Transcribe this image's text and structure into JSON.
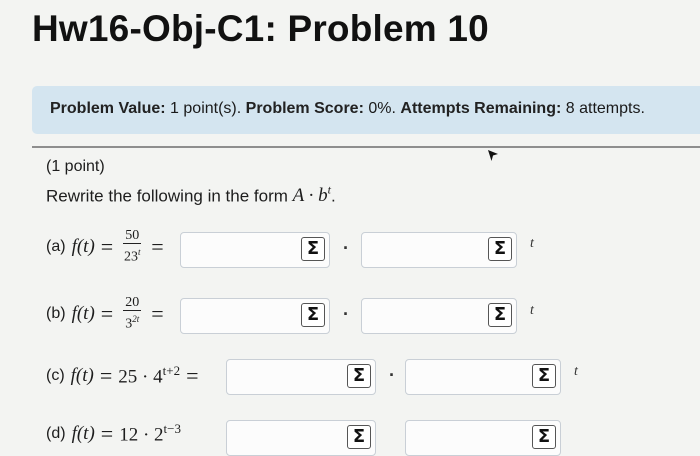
{
  "page": {
    "title": "Hw16-Obj-C1: Problem 10"
  },
  "status": {
    "value_label": "Problem Value:",
    "value_text": "1 point(s).",
    "score_label": "Problem Score:",
    "score_text": "0%.",
    "attempts_label": "Attempts Remaining:",
    "attempts_text": "8 attempts."
  },
  "problem": {
    "points": "(1 point)",
    "instructions_prefix": "Rewrite the following in the form",
    "form_expression": "A · b",
    "form_exponent": "t",
    "form_suffix": "."
  },
  "parts": [
    {
      "label": "(a)",
      "lhs": "f(t)",
      "numerator": "50",
      "denominator_base": "23",
      "denominator_exp": "t"
    },
    {
      "label": "(b)",
      "lhs": "f(t)",
      "numerator": "20",
      "denominator_base": "3",
      "denominator_exp": "2t"
    },
    {
      "label": "(c)",
      "lhs": "f(t)",
      "rhs_base": "25 · 4",
      "rhs_exp": "t+2"
    },
    {
      "label": "(d)",
      "lhs": "f(t)",
      "rhs_base": "12 · 2",
      "rhs_exp": "t−3"
    }
  ],
  "answer": {
    "equation_button": "Σ",
    "multiply_symbol": "·",
    "variable": "t",
    "equals": "="
  },
  "colors": {
    "status_background": "#d4e5f0",
    "page_background": "#f3f4f2",
    "input_border": "#c9cfd6"
  }
}
